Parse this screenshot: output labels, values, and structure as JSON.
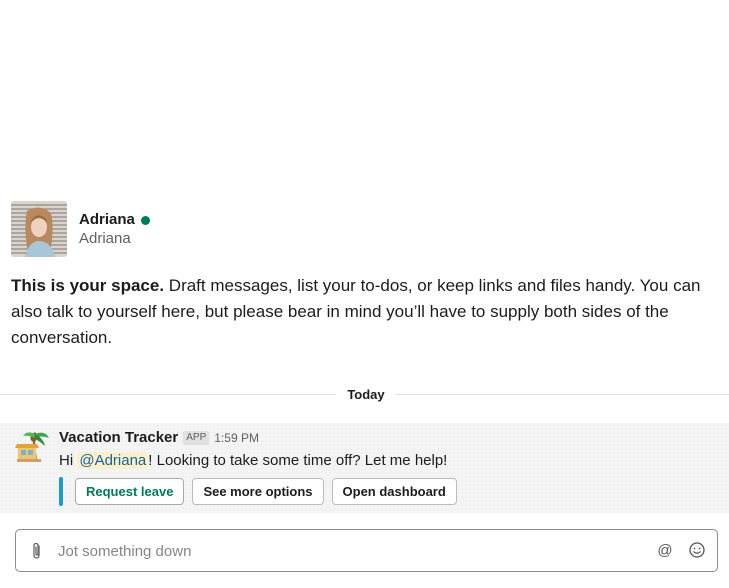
{
  "profile": {
    "name": "Adriana",
    "handle": "Adriana",
    "presence_color": "#007a5a"
  },
  "intro": {
    "lead": "This is your space.",
    "text": " Draft messages, list your to-dos, or keep links and files handy. You can also talk to yourself here, but please bear in mind you’ll have to supply both sides of the conversation."
  },
  "divider": {
    "label": "Today"
  },
  "message": {
    "app_icon": "beach-hut-icon",
    "sender": "Vacation Tracker",
    "badge": "APP",
    "time": "1:59 PM",
    "text_before": "Hi ",
    "mention": "@Adriana",
    "text_after": "! Looking to take some time off? Let me help!",
    "actions": [
      {
        "label": "Request leave"
      },
      {
        "label": "See more options"
      },
      {
        "label": "Open dashboard"
      }
    ],
    "accent_color": "#1c9ad6"
  },
  "composer": {
    "placeholder": "Jot something down",
    "value": "",
    "icons": [
      "paperclip-icon",
      "at-icon",
      "emoji-icon"
    ]
  }
}
